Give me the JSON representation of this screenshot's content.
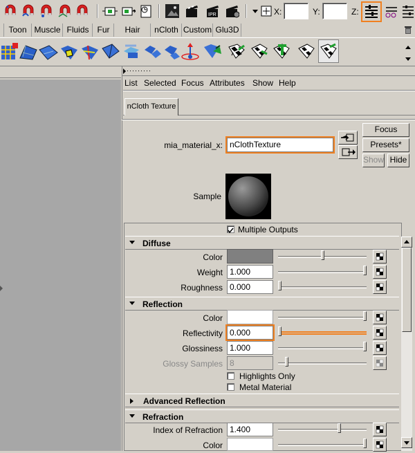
{
  "status_line": {
    "coord_labels": {
      "x": "X:",
      "y": "Y:",
      "z": "Z:"
    },
    "x_value": "",
    "y_value": "",
    "icons": [
      "select-by-hierarchy-icon",
      "select-by-object-icon",
      "select-by-component-icon",
      "snap-to-grid-icon",
      "snap-to-curve-icon",
      "snap-to-point-icon",
      "construction-history-icon",
      "render-icon",
      "ipr-render-icon",
      "render-settings-icon",
      "input-line-menu-icon",
      "absolute-transform-icon",
      "attribute-editor-toggle-icon",
      "tool-settings-icon",
      "channel-box-icon",
      "trash-icon"
    ]
  },
  "shelf_tabs": [
    "Toon",
    "Muscle",
    "Fluids",
    "Fur",
    "Hair",
    "nCloth",
    "Custom",
    "Glu3D"
  ],
  "shelf_icons": [
    "ncloth-create-icon",
    "ncloth-mesh-icon",
    "ncloth-passive-icon",
    "ncloth-constraint-icon",
    "ncloth-component-icon",
    "ncloth-transform-icon",
    "ncloth-collide-icon",
    "ncloth-cache-icon",
    "ncloth-cache-append-icon",
    "ncloth-field-icon",
    "ncloth-texture-map-icon",
    "ncloth-checker-icon",
    "ncloth-checker-scale-icon",
    "ncloth-checker-t-icon",
    "ncloth-checker-tile-icon",
    "ncloth-uv-icon"
  ],
  "attribute_editor": {
    "menu": [
      "List",
      "Selected",
      "Focus",
      "Attributes",
      "Show",
      "Help"
    ],
    "node_tab": "nCloth Texture",
    "node_type_label": "mia_material_x:",
    "node_name": "nClothTexture",
    "buttons": {
      "focus": "Focus",
      "presets": "Presets*",
      "show": "Show",
      "hide": "Hide"
    },
    "sample_label": "Sample",
    "multiple_outputs": "Multiple Outputs",
    "sections": {
      "diffuse": "Diffuse",
      "reflection": "Reflection",
      "advanced_reflection": "Advanced Reflection",
      "refraction": "Refraction"
    },
    "diffuse": {
      "color_label": "Color",
      "weight_label": "Weight",
      "weight_value": "1.000",
      "roughness_label": "Roughness",
      "roughness_value": "0.000"
    },
    "reflection": {
      "color_label": "Color",
      "reflectivity_label": "Reflectivity",
      "reflectivity_value": "0.000",
      "glossiness_label": "Glossiness",
      "glossiness_value": "1.000",
      "glossy_samples_label": "Glossy Samples",
      "glossy_samples_value": "8",
      "highlights_only": "Highlights Only",
      "metal_material": "Metal Material"
    },
    "refraction": {
      "ior_label": "Index of Refraction",
      "ior_value": "1.400",
      "color_label": "Color"
    },
    "sliders": {
      "diffuse_color": 0.5,
      "diffuse_weight": 1.0,
      "diffuse_roughness": 0.0,
      "reflection_color": 1.0,
      "reflectivity": 0.0,
      "glossiness": 1.0,
      "glossy_samples": 0.08,
      "ior": 0.7,
      "refraction_color": 1.0
    },
    "colors": {
      "diffuse_color": "#808080",
      "reflection_color": "#ffffff",
      "refraction_color": "#ffffff",
      "highlight": "#f08020"
    }
  }
}
